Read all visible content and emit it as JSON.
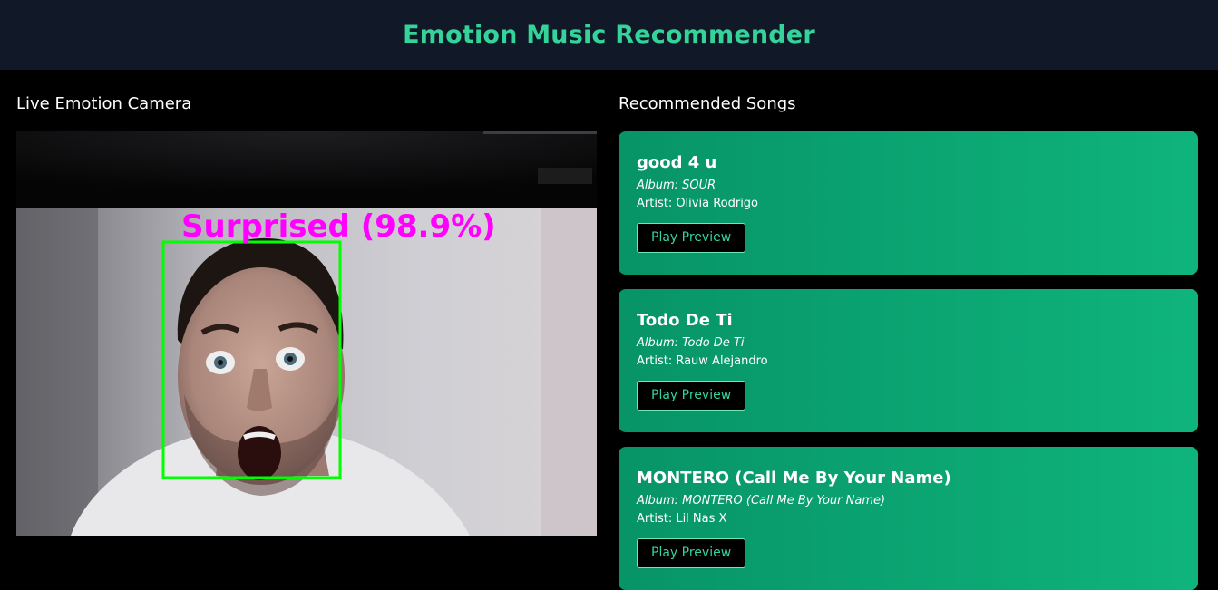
{
  "app": {
    "title": "Emotion Music Recommender"
  },
  "camera": {
    "heading": "Live Emotion Camera",
    "detection": {
      "emotion": "Surprised",
      "confidence_text": "(98.9%)",
      "label": "Surprised (98.9%)"
    },
    "colors": {
      "label": "#ff00ff",
      "box": "#00ff00"
    }
  },
  "songs": {
    "heading": "Recommended Songs",
    "items": [
      {
        "title": "good 4 u",
        "album": "Album: SOUR",
        "artist": "Artist: Olivia Rodrigo",
        "button": "Play Preview"
      },
      {
        "title": "Todo De Ti",
        "album": "Album: Todo De Ti",
        "artist": "Artist: Rauw Alejandro",
        "button": "Play Preview"
      },
      {
        "title": "MONTERO (Call Me By Your Name)",
        "album": "Album: MONTERO (Call Me By Your Name)",
        "artist": "Artist: Lil Nas X",
        "button": "Play Preview"
      }
    ]
  },
  "theme": {
    "accent": "#34d399",
    "header_bg": "#111827",
    "card_start": "#079467",
    "card_end": "#0fb47c"
  }
}
